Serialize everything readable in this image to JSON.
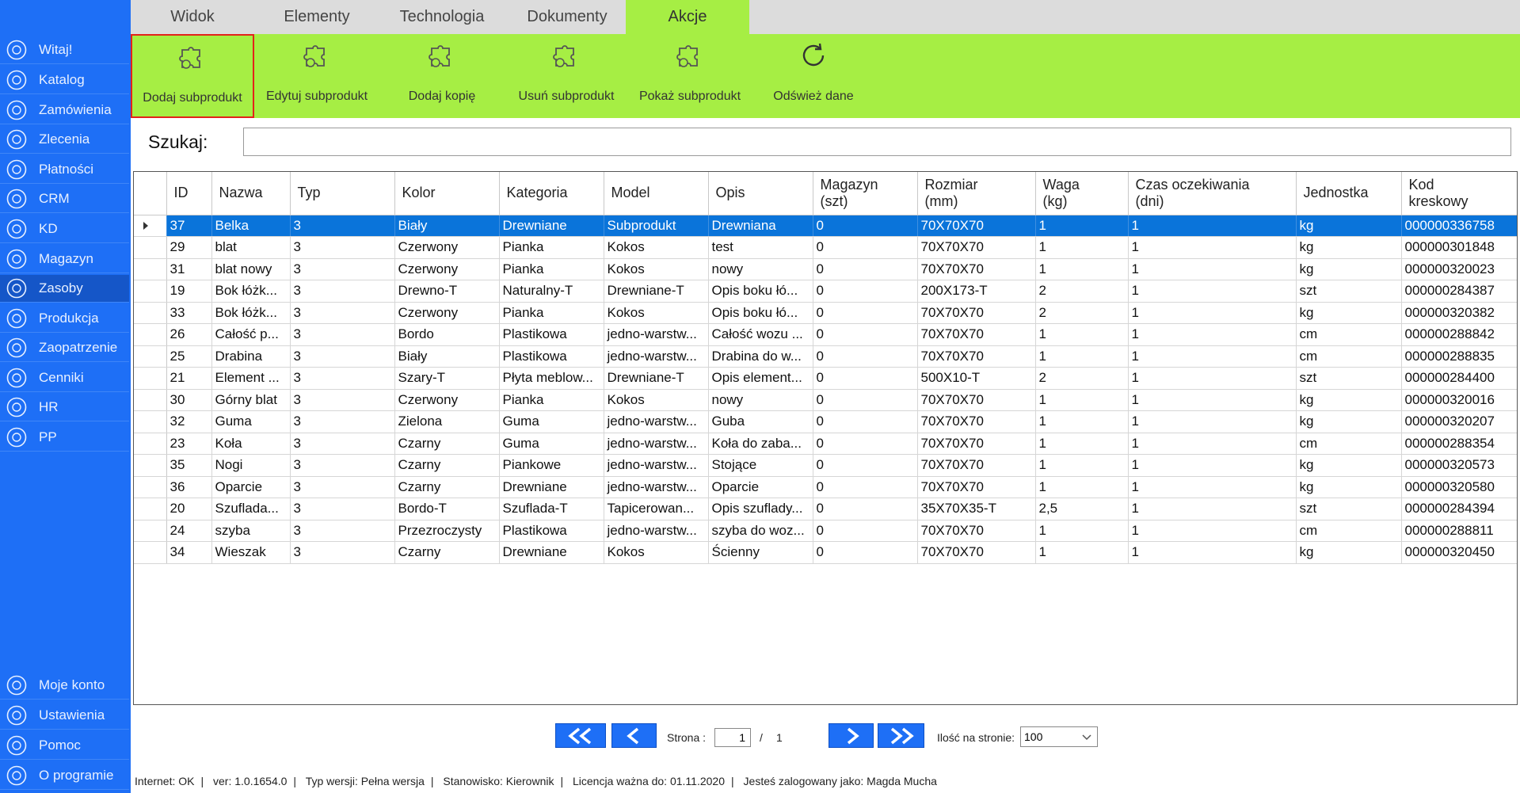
{
  "sidebar": {
    "items": [
      {
        "label": "Witaj!",
        "icon": "home-icon"
      },
      {
        "label": "Katalog",
        "icon": "book-icon"
      },
      {
        "label": "Zamówienia",
        "icon": "cart-icon"
      },
      {
        "label": "Zlecenia",
        "icon": "list-icon"
      },
      {
        "label": "Płatności",
        "icon": "dollar-icon"
      },
      {
        "label": "CRM",
        "icon": "crm-icon"
      },
      {
        "label": "KD",
        "icon": "person-icon"
      },
      {
        "label": "Magazyn",
        "icon": "warehouse-icon"
      },
      {
        "label": "Zasoby",
        "icon": "resources-icon"
      },
      {
        "label": "Produkcja",
        "icon": "production-icon"
      },
      {
        "label": "Zaopatrzenie",
        "icon": "supply-icon"
      },
      {
        "label": "Cenniki",
        "icon": "tag-icon"
      },
      {
        "label": "HR",
        "icon": "hr-icon"
      },
      {
        "label": "PP",
        "icon": "chart-icon"
      }
    ],
    "bottom_items": [
      {
        "label": "Moje konto",
        "icon": "user-icon"
      },
      {
        "label": "Ustawienia",
        "icon": "gear-icon"
      },
      {
        "label": "Pomoc",
        "icon": "help-icon"
      },
      {
        "label": "O programie",
        "icon": "info-icon"
      }
    ],
    "active": "Zasoby"
  },
  "tabs": [
    {
      "label": "Widok"
    },
    {
      "label": "Elementy"
    },
    {
      "label": "Technologia"
    },
    {
      "label": "Dokumenty"
    },
    {
      "label": "Akcje"
    }
  ],
  "active_tab": "Akcje",
  "ribbon": {
    "buttons": [
      {
        "label": "Dodaj subprodukt",
        "icon": "puzzle-add-icon"
      },
      {
        "label": "Edytuj subprodukt",
        "icon": "puzzle-edit-icon"
      },
      {
        "label": "Dodaj kopię",
        "icon": "puzzle-copy-icon"
      },
      {
        "label": "Usuń subprodukt",
        "icon": "puzzle-delete-icon"
      },
      {
        "label": "Pokaż subprodukt",
        "icon": "puzzle-show-icon"
      },
      {
        "label": "Odśwież dane",
        "icon": "refresh-icon"
      }
    ]
  },
  "search": {
    "label": "Szukaj:",
    "value": ""
  },
  "table": {
    "columns": [
      "ID",
      "Nazwa",
      "Typ",
      "Kolor",
      "Kategoria",
      "Model",
      "Opis",
      "Magazyn\n(szt)",
      "Rozmiar\n(mm)",
      "Waga\n(kg)",
      "Czas oczekiwania\n(dni)",
      "Jednostka",
      "Kod\nkreskowy"
    ],
    "rows": [
      [
        "37",
        "Belka",
        "3",
        "Biały",
        "Drewniane",
        "Subprodukt",
        "Drewniana",
        "0",
        "70X70X70",
        "1",
        "1",
        "kg",
        "000000336758"
      ],
      [
        "29",
        "blat",
        "3",
        "Czerwony",
        "Pianka",
        "Kokos",
        "test",
        "0",
        "70X70X70",
        "1",
        "1",
        "kg",
        "000000301848"
      ],
      [
        "31",
        "blat nowy",
        "3",
        "Czerwony",
        "Pianka",
        "Kokos",
        "nowy",
        "0",
        "70X70X70",
        "1",
        "1",
        "kg",
        "000000320023"
      ],
      [
        "19",
        "Bok łóżk...",
        "3",
        "Drewno-T",
        "Naturalny-T",
        "Drewniane-T",
        "Opis boku łó...",
        "0",
        "200X173-T",
        "2",
        "1",
        "szt",
        "000000284387"
      ],
      [
        "33",
        "Bok łóżk...",
        "3",
        "Czerwony",
        "Pianka",
        "Kokos",
        "Opis boku łó...",
        "0",
        "70X70X70",
        "2",
        "1",
        "kg",
        "000000320382"
      ],
      [
        "26",
        "Całość p...",
        "3",
        "Bordo",
        "Plastikowa",
        "jedno-warstw...",
        "Całość wozu ...",
        "0",
        "70X70X70",
        "1",
        "1",
        "cm",
        "000000288842"
      ],
      [
        "25",
        "Drabina",
        "3",
        "Biały",
        "Plastikowa",
        "jedno-warstw...",
        "Drabina do w...",
        "0",
        "70X70X70",
        "1",
        "1",
        "cm",
        "000000288835"
      ],
      [
        "21",
        "Element ...",
        "3",
        "Szary-T",
        "Płyta meblow...",
        "Drewniane-T",
        "Opis element...",
        "0",
        "500X10-T",
        "2",
        "1",
        "szt",
        "000000284400"
      ],
      [
        "30",
        "Górny blat",
        "3",
        "Czerwony",
        "Pianka",
        "Kokos",
        "nowy",
        "0",
        "70X70X70",
        "1",
        "1",
        "kg",
        "000000320016"
      ],
      [
        "32",
        "Guma",
        "3",
        "Zielona",
        "Guma",
        "jedno-warstw...",
        "Guba",
        "0",
        "70X70X70",
        "1",
        "1",
        "kg",
        "000000320207"
      ],
      [
        "23",
        "Koła",
        "3",
        "Czarny",
        "Guma",
        "jedno-warstw...",
        "Koła do zaba...",
        "0",
        "70X70X70",
        "1",
        "1",
        "cm",
        "000000288354"
      ],
      [
        "35",
        "Nogi",
        "3",
        "Czarny",
        "Piankowe",
        "jedno-warstw...",
        "Stojące",
        "0",
        "70X70X70",
        "1",
        "1",
        "kg",
        "000000320573"
      ],
      [
        "36",
        "Oparcie",
        "3",
        "Czarny",
        "Drewniane",
        "jedno-warstw...",
        "Oparcie",
        "0",
        "70X70X70",
        "1",
        "1",
        "kg",
        "000000320580"
      ],
      [
        "20",
        "Szuflada...",
        "3",
        "Bordo-T",
        "Szuflada-T",
        "Tapicerowan...",
        "Opis szuflady...",
        "0",
        "35X70X35-T",
        "2,5",
        "1",
        "szt",
        "000000284394"
      ],
      [
        "24",
        "szyba",
        "3",
        "Przezroczysty",
        "Plastikowa",
        "jedno-warstw...",
        "szyba do woz...",
        "0",
        "70X70X70",
        "1",
        "1",
        "cm",
        "000000288811"
      ],
      [
        "34",
        "Wieszak",
        "3",
        "Czarny",
        "Drewniane",
        "Kokos",
        "Ścienny",
        "0",
        "70X70X70",
        "1",
        "1",
        "kg",
        "000000320450"
      ]
    ],
    "selected_row": 0
  },
  "pager": {
    "page_label": "Strona :",
    "page_value": "1",
    "separator": "/",
    "total_pages": "1",
    "per_page_label": "Ilość na stronie:",
    "per_page_value": "100"
  },
  "status": {
    "internet": "Internet: OK",
    "version": "ver: 1.0.1654.0",
    "version_type": "Typ wersji: Pełna wersja",
    "station": "Stanowisko: Kierownik",
    "license": "Licencja ważna do: 01.11.2020",
    "user": "Jesteś zalogowany jako: Magda Mucha"
  },
  "colors": {
    "sidebar": "#1e6ff6",
    "ribbon": "#a6ee44",
    "selection": "#0a74da",
    "highlight_border": "#e2231a"
  }
}
